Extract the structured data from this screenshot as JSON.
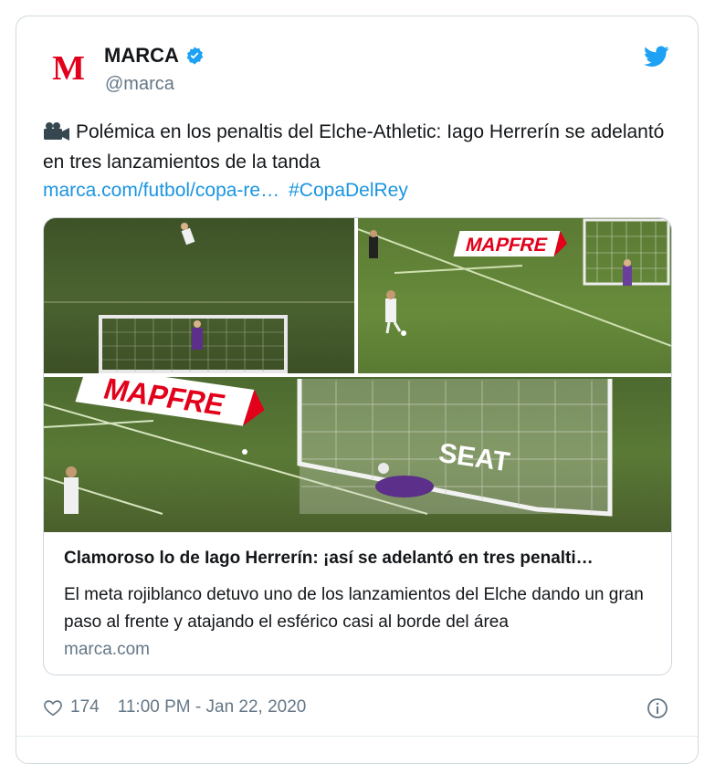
{
  "author": {
    "name": "MARCA",
    "handle": "@marca",
    "avatar_letter": "M",
    "verified": true
  },
  "tweet": {
    "text": "Polémica en los penaltis del Elche-Athletic: Iago Herrerín se adelantó en tres lanzamientos de la tanda",
    "link": "marca.com/futbol/copa-re…",
    "hashtag": "#CopaDelRey"
  },
  "card": {
    "title": "Clamoroso lo de Iago Herrerín: ¡así se adelantó en tres penalti…",
    "description": "El meta rojiblanco detuvo uno de los lanzamientos del Elche dando un gran paso al frente y atajando el esférico casi al borde del área",
    "domain": "marca.com",
    "images": [
      {
        "banner": ""
      },
      {
        "banner": "MAPFRE"
      },
      {
        "banner": "MAPFRE",
        "board": "SEAT"
      }
    ]
  },
  "footer": {
    "likes": "174",
    "timestamp": "11:00 PM - Jan 22, 2020"
  },
  "colors": {
    "link": "#1b95e0",
    "twitter": "#1da1f2",
    "brand_red": "#e2001a"
  },
  "icons": [
    "twitter-logo-icon",
    "verified-icon",
    "video-camera-icon",
    "heart-icon",
    "info-icon"
  ]
}
